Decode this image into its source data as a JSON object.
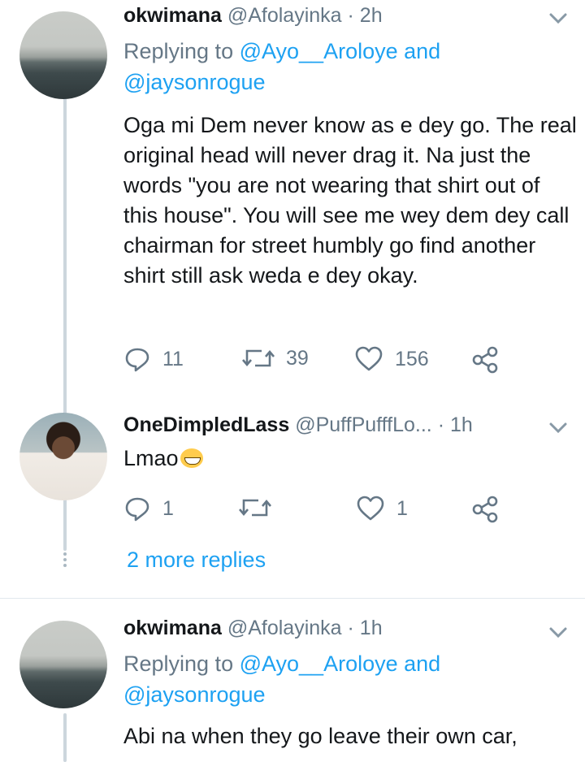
{
  "tweets": [
    {
      "name": "okwimana",
      "handle": "@Afolayinka",
      "time": "· 2h",
      "replying_prefix": "Replying to ",
      "replying_user1": "@Ayo__Aroloye",
      "replying_and": " and",
      "replying_user2": "@jaysonrogue",
      "text": "Oga mi Dem never know as e dey go. The real original head will never drag it. Na just the words \"you are not wearing that shirt out of this house\". You will see me wey dem dey call chairman for street humbly go find another shirt still ask weda e dey okay.",
      "replies": "11",
      "retweets": "39",
      "likes": "156"
    },
    {
      "name": "OneDimpledLass",
      "handle": "@PuffPufffLo...",
      "time": "· 1h",
      "text": "Lmao",
      "emoji": "grinning-squinting-face",
      "replies": "1",
      "retweets": "",
      "likes": "1"
    },
    {
      "name": "okwimana",
      "handle": "@Afolayinka",
      "time": "· 1h",
      "replying_prefix": "Replying to ",
      "replying_user1": "@Ayo__Aroloye",
      "replying_and": " and",
      "replying_user2": "@jaysonrogue",
      "text": "Abi na when they go leave their own car,"
    }
  ],
  "more_replies": "2 more replies",
  "colors": {
    "link": "#1da1f2",
    "secondary": "#657786",
    "thread_line": "#ccd6dd"
  }
}
